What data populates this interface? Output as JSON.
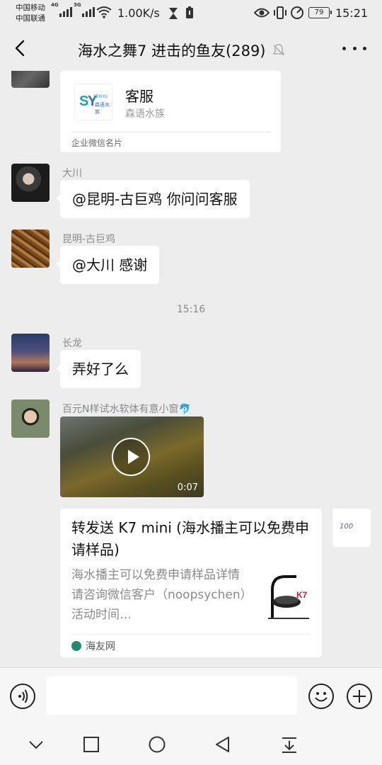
{
  "status_bar": {
    "carrier_1": "中国移动",
    "carrier_2": "中国联通",
    "net_1": "4G",
    "net_2": "3G",
    "speed": "1.00K/s",
    "battery": "79",
    "time": "15:21"
  },
  "header": {
    "title": "海水之舞7 进击的鱼友(289)"
  },
  "messages": [
    {
      "type": "contact-card",
      "card_name": "客服",
      "card_sub": "森语水族",
      "card_type": "企业微信名片",
      "logo_text": "SENYU",
      "logo_sub": "森语水族"
    },
    {
      "type": "text",
      "sender": "大川",
      "text": "@昆明-古巨鸡  你问问客服"
    },
    {
      "type": "text",
      "sender": "昆明-古巨鸡",
      "text": "@大川  感谢"
    },
    {
      "type": "timestamp",
      "text": "15:16"
    },
    {
      "type": "text",
      "sender": "长龙",
      "text": "弄好了么"
    },
    {
      "type": "video",
      "sender": "百元N样试水软体有意小窗🐬",
      "duration": "0:07"
    },
    {
      "type": "link-card",
      "title": "转发送 K7 mini (海水播主可以免费申请样品)",
      "desc": "海水播主可以免费申请样品详情请咨询微信客户（noopsychen）活动时间…",
      "source": "海友网",
      "thumb_logo": "K7",
      "side_avatar_text": "100"
    }
  ],
  "colors": {
    "background": "#ededed",
    "bubble": "#ffffff",
    "meta_text": "#8a8a8a"
  }
}
